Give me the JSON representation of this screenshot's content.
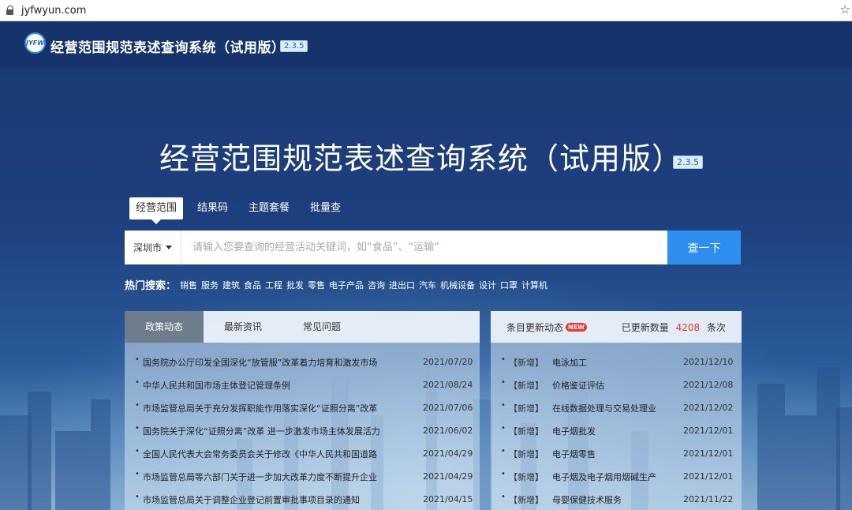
{
  "browser": {
    "url": "jyfwyun.com"
  },
  "header": {
    "logo_text": "JYFW",
    "title": "经营范围规范表述查询系统（试用版）",
    "version": "2.3.5"
  },
  "hero": {
    "title": "经营范围规范表述查询系统（试用版）",
    "version": "2.3.5"
  },
  "search_tabs": [
    {
      "label": "经营范围",
      "active": true
    },
    {
      "label": "结果码",
      "active": false
    },
    {
      "label": "主题套餐",
      "active": false
    },
    {
      "label": "批量查",
      "active": false
    }
  ],
  "search": {
    "city": "深圳市",
    "placeholder": "请输入您要查询的经营活动关键词，如“食品”、“运输”",
    "button": "查一下"
  },
  "hot": {
    "label": "热门搜索：",
    "keywords": [
      "销售",
      "服务",
      "建筑",
      "食品",
      "工程",
      "批发",
      "零售",
      "电子产品",
      "咨询",
      "进出口",
      "汽车",
      "机械设备",
      "设计",
      "口罩",
      "计算机"
    ]
  },
  "news_panel": {
    "tabs": [
      {
        "label": "政策动态",
        "active": true
      },
      {
        "label": "最新资讯",
        "active": false
      },
      {
        "label": "常见问题",
        "active": false
      }
    ],
    "items": [
      {
        "title": "国务院办公厅印发全国深化“放管服”改革着力培育和激发市场",
        "date": "2021/07/20"
      },
      {
        "title": "中华人民共和国市场主体登记管理条例",
        "date": "2021/08/24"
      },
      {
        "title": "市场监管总局关于充分发挥职能作用落实深化“证照分离”改革",
        "date": "2021/07/06"
      },
      {
        "title": "国务院关于深化“证照分离”改革 进一步激发市场主体发展活力",
        "date": "2021/06/02"
      },
      {
        "title": "全国人民代表大会常务委员会关于修改《中华人民共和国道路",
        "date": "2021/04/29"
      },
      {
        "title": "市场监管总局等六部门关于进一步加大改革力度不断提升企业",
        "date": "2021/04/29"
      },
      {
        "title": "市场监管总局关于调整企业登记前置审批事项目录的通知",
        "date": "2021/04/15"
      }
    ]
  },
  "update_panel": {
    "title": "条目更新动态",
    "badge": "NEW",
    "count_label": "已更新数量",
    "count": "4208",
    "count_unit": "条次",
    "items": [
      {
        "tag": "【新增】",
        "name": "电泳加工",
        "date": "2021/12/10"
      },
      {
        "tag": "【新增】",
        "name": "价格鉴证评估",
        "date": "2021/12/08"
      },
      {
        "tag": "【新增】",
        "name": "在线数据处理与交易处理业",
        "date": "2021/12/02"
      },
      {
        "tag": "【新增】",
        "name": "电子烟批发",
        "date": "2021/12/01"
      },
      {
        "tag": "【新增】",
        "name": "电子烟零售",
        "date": "2021/12/01"
      },
      {
        "tag": "【新增】",
        "name": "电子烟及电子烟用烟碱生产",
        "date": "2021/12/01"
      },
      {
        "tag": "【新增】",
        "name": "母婴保健技术服务",
        "date": "2021/11/22"
      }
    ]
  }
}
